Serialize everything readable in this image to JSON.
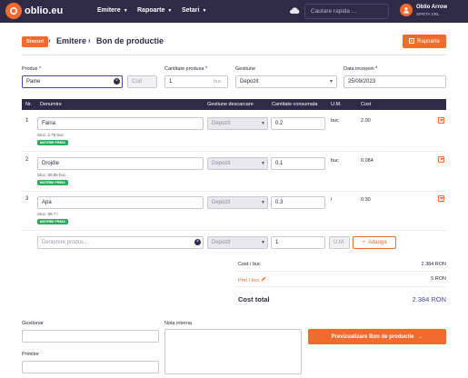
{
  "app": {
    "logo_text": "oblio.eu",
    "nav": [
      "Emitere",
      "Rapoarte",
      "Setari"
    ],
    "search_placeholder": "Cautare rapida ...",
    "user_name": "Oblio Arrow",
    "user_company": "SIPETA SRL"
  },
  "header": {
    "breadcrumb_root": "Stocuri",
    "breadcrumb_1": "Emitere",
    "breadcrumb_2": "Bon de productie",
    "rapoarte_button": "Rapoarte"
  },
  "form": {
    "produs_label": "Produs *",
    "produs_value": "Paine",
    "cod_placeholder": "Cod",
    "cantitate_label": "Cantitate produsa *",
    "cantitate_value": "1",
    "cantitate_unit": "buc",
    "gestiune_label": "Gestiune",
    "gestiune_value": "Depozit",
    "data_label": "Data inceperii *",
    "data_value": "25/09/2023"
  },
  "table": {
    "headers": {
      "nr": "Nr.",
      "denumire": "Denumire",
      "gestiune": "Gestiune descarcare",
      "cantitate": "Cantitate consumata",
      "um": "U.M.",
      "cost": "Cost"
    },
    "rows": [
      {
        "nr": "1",
        "denumire": "Faina",
        "stoc": "Stoc: 2.75 buc",
        "badge": "MATERIE PRIMA",
        "gestiune": "Depozit",
        "cantitate": "0.2",
        "um": "buc",
        "cost": "2.00"
      },
      {
        "nr": "2",
        "denumire": "Drojdie",
        "stoc": "Stoc: 90.85 buc",
        "badge": "MATERIE PRIMA",
        "gestiune": "Depozit",
        "cantitate": "0.1",
        "um": "buc",
        "cost": "0.084"
      },
      {
        "nr": "3",
        "denumire": "Apa",
        "stoc": "Stoc: 99.7 l",
        "badge": "MATERIE PRIMA",
        "gestiune": "Depozit",
        "cantitate": "0.3",
        "um": "l",
        "cost": "0.30"
      }
    ],
    "new_row": {
      "denumire_placeholder": "Denumire produs...",
      "gestiune": "Depozit",
      "cantitate": "1",
      "um_placeholder": "U.M.",
      "add_button": "Adauga"
    }
  },
  "totals": {
    "cost_buc_label": "Cost / buc",
    "cost_buc_value": "2.384 RON",
    "pret_buc_label": "Pret / buc",
    "pret_buc_value": "5 RON",
    "cost_total_label": "Cost total",
    "cost_total_value": "2.384 RON"
  },
  "bottom": {
    "gestionar_label": "Gestionar",
    "primitor_label": "Primitor",
    "nota_label": "Nota interna",
    "preview_button": "Previzualizare Bon de productie"
  },
  "colors": {
    "accent": "#f26b2e",
    "navbar": "#2f2a48",
    "badge": "#2eaa5e",
    "link": "#4a47a3"
  }
}
